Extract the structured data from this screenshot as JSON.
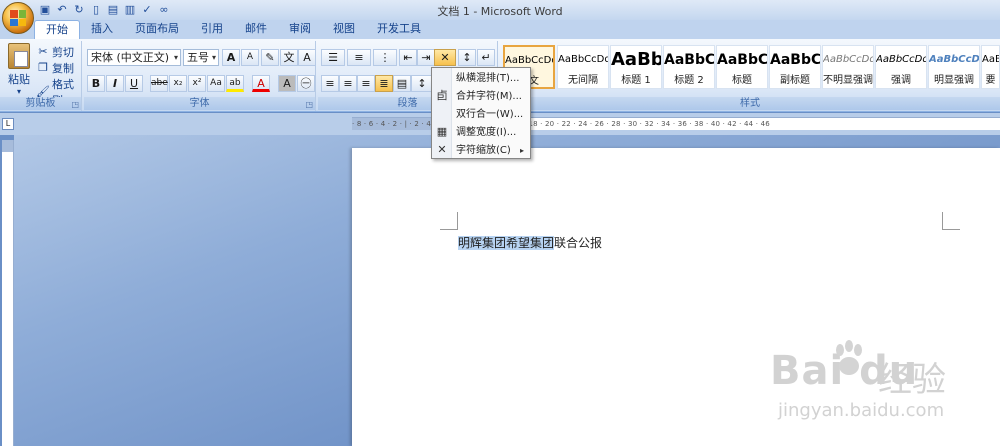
{
  "window": {
    "title": "文档 1 - Microsoft Word"
  },
  "qat": {
    "icons": [
      "save-icon",
      "undo-icon",
      "redo-icon",
      "new-icon",
      "open-icon",
      "print-icon",
      "check-icon",
      "more-icon"
    ]
  },
  "tabs": [
    {
      "label": "开始",
      "active": true
    },
    {
      "label": "插入"
    },
    {
      "label": "页面布局"
    },
    {
      "label": "引用"
    },
    {
      "label": "邮件"
    },
    {
      "label": "审阅"
    },
    {
      "label": "视图"
    },
    {
      "label": "开发工具"
    }
  ],
  "clipboard": {
    "group_label": "剪贴板",
    "paste": "粘贴",
    "cut": "剪切",
    "copy": "复制",
    "format_painter": "格式刷"
  },
  "font": {
    "group_label": "字体",
    "font_name": "宋体 (中文正文)",
    "font_size": "五号",
    "bold": "B",
    "italic": "I",
    "underline": "U",
    "strike": "abe",
    "subscript": "x₂",
    "superscript": "x²",
    "change_case": "Aa",
    "grow": "A",
    "shrink": "A",
    "font_color": "A",
    "highlight_label": "ab"
  },
  "paragraph": {
    "group_label": "段落"
  },
  "styles": {
    "group_label": "样式",
    "items": [
      {
        "sample": "AaBbCcDd",
        "name": "正文",
        "selected": true
      },
      {
        "sample": "AaBbCcDd",
        "name": "无间隔"
      },
      {
        "sample": "AaBb",
        "name": "标题 1"
      },
      {
        "sample": "AaBbC",
        "name": "标题 2"
      },
      {
        "sample": "AaBbC",
        "name": "标题"
      },
      {
        "sample": "AaBbC",
        "name": "副标题"
      },
      {
        "sample": "AaBbCcDd",
        "name": "不明显强调"
      },
      {
        "sample": "AaBbCcDd",
        "name": "强调"
      },
      {
        "sample": "AaBbCcDd",
        "name": "明显强调"
      },
      {
        "sample": "AaBbCcDd",
        "name": "要"
      }
    ]
  },
  "ruler": {
    "marks": "· 8 · 6 · 4 · 2 · | · 2 · 4 · 6 · 8 · 10 · 12 · 14 · 16 · 18 · 20 · 22 · 24 · 26 · 28 · 30 · 32 · 34 · 36 · 38 · 40 · 42 · 44 · 46"
  },
  "menu": {
    "items": [
      {
        "label": "纵横混排(T)...",
        "icon": ""
      },
      {
        "label": "合并字符(M)...",
        "icon": "combine-chars-icon"
      },
      {
        "label": "双行合一(W)...",
        "icon": ""
      },
      {
        "label": "调整宽度(I)...",
        "icon": "adjust-width-icon"
      },
      {
        "label": "字符缩放(C)",
        "icon": "char-scale-icon",
        "submenu": true
      }
    ]
  },
  "document": {
    "selected_text": "明辉集团希望集团",
    "rest_text": "联合公报"
  },
  "watermark": {
    "logo": "Bai du",
    "brand_cn": "经验",
    "url": "jingyan.baidu.com"
  },
  "colors": {
    "accent": "#15428b",
    "ribbon_bg": "#dbe7f7",
    "selection": "#b7d3f2",
    "highlight_btn": "#f6c04d"
  }
}
